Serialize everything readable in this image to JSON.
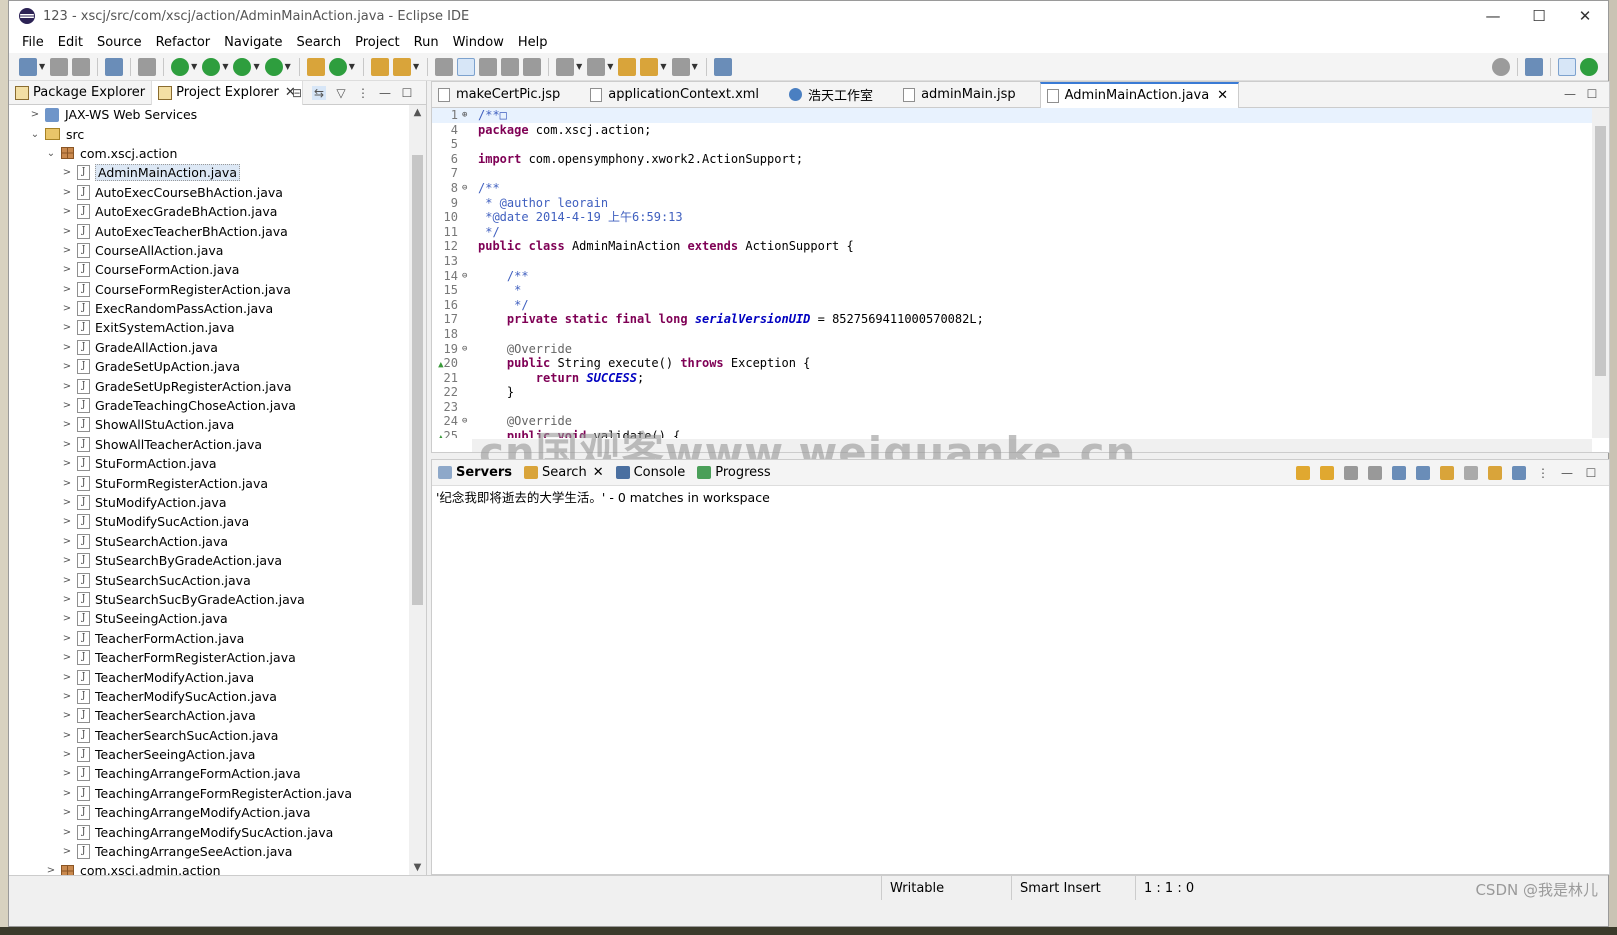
{
  "window": {
    "title": "123 - xscj/src/com/xscj/action/AdminMainAction.java - Eclipse IDE",
    "controls": {
      "minimize": "—",
      "maximize": "☐",
      "close": "✕"
    }
  },
  "menu": [
    "File",
    "Edit",
    "Source",
    "Refactor",
    "Navigate",
    "Search",
    "Project",
    "Run",
    "Window",
    "Help"
  ],
  "left_panel": {
    "tabs": [
      {
        "label": "Package Explorer",
        "active": true
      },
      {
        "label": "Project Explorer",
        "active": false,
        "close": "✕"
      }
    ],
    "tree": {
      "jaxws": "JAX-WS Web Services",
      "src": "src",
      "package": "com.xscj.action",
      "files": [
        "AdminMainAction.java",
        "AutoExecCourseBhAction.java",
        "AutoExecGradeBhAction.java",
        "AutoExecTeacherBhAction.java",
        "CourseAllAction.java",
        "CourseFormAction.java",
        "CourseFormRegisterAction.java",
        "ExecRandomPassAction.java",
        "ExitSystemAction.java",
        "GradeAllAction.java",
        "GradeSetUpAction.java",
        "GradeSetUpRegisterAction.java",
        "GradeTeachingChoseAction.java",
        "ShowAllStuAction.java",
        "ShowAllTeacherAction.java",
        "StuFormAction.java",
        "StuFormRegisterAction.java",
        "StuModifyAction.java",
        "StuModifySucAction.java",
        "StuSearchAction.java",
        "StuSearchByGradeAction.java",
        "StuSearchSucAction.java",
        "StuSearchSucByGradeAction.java",
        "StuSeeingAction.java",
        "TeacherFormAction.java",
        "TeacherFormRegisterAction.java",
        "TeacherModifyAction.java",
        "TeacherModifySucAction.java",
        "TeacherSearchAction.java",
        "TeacherSearchSucAction.java",
        "TeacherSeeingAction.java",
        "TeachingArrangeFormAction.java",
        "TeachingArrangeFormRegisterAction.java",
        "TeachingArrangeModifyAction.java",
        "TeachingArrangeModifySucAction.java",
        "TeachingArrangeSeeAction.java"
      ],
      "selected_file": "AdminMainAction.java",
      "next_package": "com.xscj.admin.action"
    }
  },
  "editor": {
    "tabs": [
      {
        "label": "makeCertPic.jsp",
        "icon": "file-icon"
      },
      {
        "label": "applicationContext.xml",
        "icon": "xml-icon"
      },
      {
        "label": "浩天工作室",
        "icon": "globe-icon"
      },
      {
        "label": "adminMain.jsp",
        "icon": "file-icon"
      },
      {
        "label": "AdminMainAction.java",
        "icon": "java-icon",
        "active": true,
        "close": "✕"
      }
    ],
    "lines": [
      {
        "n": "1",
        "fold": "⊕",
        "text": "/**□"
      },
      {
        "n": "4",
        "text": "package com.xscj.action;"
      },
      {
        "n": "5",
        "text": ""
      },
      {
        "n": "6",
        "text": "import com.opensymphony.xwork2.ActionSupport;"
      },
      {
        "n": "7",
        "text": ""
      },
      {
        "n": "8",
        "fold": "⊖",
        "text": "/**"
      },
      {
        "n": "9",
        "text": " * @author leorain"
      },
      {
        "n": "10",
        "text": " *@date 2014-4-19 上午6:59:13"
      },
      {
        "n": "11",
        "text": " */"
      },
      {
        "n": "12",
        "text": "public class AdminMainAction extends ActionSupport {"
      },
      {
        "n": "13",
        "text": ""
      },
      {
        "n": "14",
        "fold": "⊖",
        "text": "    /**"
      },
      {
        "n": "15",
        "text": "     *"
      },
      {
        "n": "16",
        "text": "     */"
      },
      {
        "n": "17",
        "text": "    private static final long serialVersionUID = 8527569411000570082L;"
      },
      {
        "n": "18",
        "text": ""
      },
      {
        "n": "19",
        "fold": "⊖",
        "text": "    @Override"
      },
      {
        "n": "20",
        "marker": "▲",
        "text": "    public String execute() throws Exception {"
      },
      {
        "n": "21",
        "text": "        return SUCCESS;"
      },
      {
        "n": "22",
        "text": "    }"
      },
      {
        "n": "23",
        "text": ""
      },
      {
        "n": "24",
        "fold": "⊖",
        "text": "    @Override"
      },
      {
        "n": "25",
        "marker": "▲",
        "text": "    public void validate() {"
      }
    ],
    "watermark": "cn国观客www.weiguanke.cn"
  },
  "bottom_panel": {
    "tabs": [
      {
        "label": "Servers",
        "active": true
      },
      {
        "label": "Search",
        "close": "✕"
      },
      {
        "label": "Console"
      },
      {
        "label": "Progress"
      }
    ],
    "search_result": "'纪念我即将逝去的大学生活。' - 0 matches in workspace"
  },
  "status_bar": {
    "writable": "Writable",
    "insert_mode": "Smart Insert",
    "position": "1 : 1 : 0"
  },
  "overlay_watermark": "CSDN @我是林儿"
}
